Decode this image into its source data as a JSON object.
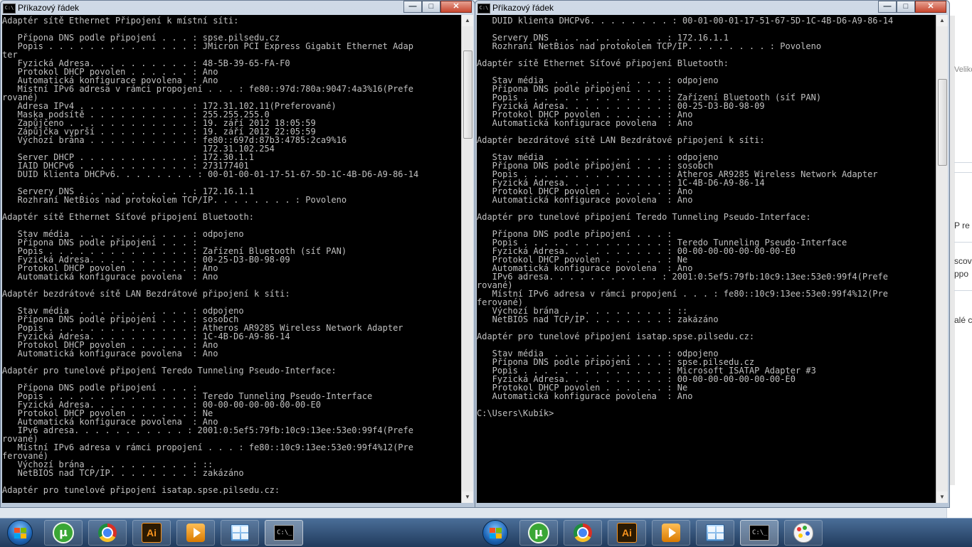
{
  "left_window": {
    "title": "Příkazový řádek",
    "lines": [
      "Adaptér sítě Ethernet Připojení k místní síti:",
      "",
      "   Přípona DNS podle připojení . . . : spse.pilsedu.cz",
      "   Popis . . . . . . . . . . . . . . : JMicron PCI Express Gigabit Ethernet Adap",
      "ter",
      "   Fyzická Adresa. . . . . . . . . . : 48-5B-39-65-FA-F0",
      "   Protokol DHCP povolen . . . . . . : Ano",
      "   Automatická konfigurace povolena  : Ano",
      "   Místní IPv6 adresa v rámci propojení . . . : fe80::97d:780a:9047:4a3%16(Prefe",
      "rované)",
      "   Adresa IPv4 . . . . . . . . . . . : 172.31.102.11(Preferované)",
      "   Maska podsítě . . . . . . . . . . : 255.255.255.0",
      "   Zapůjčeno . . . . . . . . . . . . : 19. září 2012 18:05:59",
      "   Zápůjčka vyprší . . . . . . . . . : 19. září 2012 22:05:59",
      "   Výchozí brána . . . . . . . . . . : fe80::697d:87b3:4785:2ca9%16",
      "                                       172.31.102.254",
      "   Server DHCP . . . . . . . . . . . : 172.30.1.1",
      "   IAID DHCPv6 . . . . . . . . . . . : 273177401",
      "   DUID klienta DHCPv6. . . . . . . . : 00-01-00-01-17-51-67-5D-1C-4B-D6-A9-86-14",
      "",
      "   Servery DNS . . . . . . . . . . . : 172.16.1.1",
      "   Rozhraní NetBios nad protokolem TCP/IP. . . . . . . . : Povoleno",
      "",
      "Adaptér sítě Ethernet Síťové připojení Bluetooth:",
      "",
      "   Stav média  . . . . . . . . . . . : odpojeno",
      "   Přípona DNS podle připojení . . . :",
      "   Popis . . . . . . . . . . . . . . : Zařízení Bluetooth (síť PAN)",
      "   Fyzická Adresa. . . . . . . . . . : 00-25-D3-B0-98-09",
      "   Protokol DHCP povolen . . . . . . : Ano",
      "   Automatická konfigurace povolena  : Ano",
      "",
      "Adaptér bezdrátové sítě LAN Bezdrátové připojení k síti:",
      "",
      "   Stav média  . . . . . . . . . . . : odpojeno",
      "   Přípona DNS podle připojení . . . : sosobch",
      "   Popis . . . . . . . . . . . . . . : Atheros AR9285 Wireless Network Adapter",
      "   Fyzická Adresa. . . . . . . . . . : 1C-4B-D6-A9-86-14",
      "   Protokol DHCP povolen . . . . . . : Ano",
      "   Automatická konfigurace povolena  : Ano",
      "",
      "Adaptér pro tunelové připojení Teredo Tunneling Pseudo-Interface:",
      "",
      "   Přípona DNS podle připojení . . . :",
      "   Popis . . . . . . . . . . . . . . : Teredo Tunneling Pseudo-Interface",
      "   Fyzická Adresa. . . . . . . . . . : 00-00-00-00-00-00-00-E0",
      "   Protokol DHCP povolen . . . . . . : Ne",
      "   Automatická konfigurace povolena  : Ano",
      "   IPv6 adresa. . . . . . . . . . . : 2001:0:5ef5:79fb:10c9:13ee:53e0:99f4(Prefe",
      "rované)",
      "   Místní IPv6 adresa v rámci propojení . . . : fe80::10c9:13ee:53e0:99f4%12(Pre",
      "ferované)",
      "   Výchozí brána . . . . . . . . . . : ::",
      "   NetBIOS nad TCP/IP. . . . . . . . : zakázáno",
      "",
      "Adaptér pro tunelové připojení isatap.spse.pilsedu.cz:"
    ]
  },
  "right_window": {
    "title": "Příkazový řádek",
    "lines": [
      "   DUID klienta DHCPv6. . . . . . . . : 00-01-00-01-17-51-67-5D-1C-4B-D6-A9-86-14",
      "",
      "   Servery DNS . . . . . . . . . . . : 172.16.1.1",
      "   Rozhraní NetBios nad protokolem TCP/IP. . . . . . . . : Povoleno",
      "",
      "Adaptér sítě Ethernet Síťové připojení Bluetooth:",
      "",
      "   Stav média  . . . . . . . . . . . : odpojeno",
      "   Přípona DNS podle připojení . . . :",
      "   Popis . . . . . . . . . . . . . . : Zařízení Bluetooth (síť PAN)",
      "   Fyzická Adresa. . . . . . . . . . : 00-25-D3-B0-98-09",
      "   Protokol DHCP povolen . . . . . . : Ano",
      "   Automatická konfigurace povolena  : Ano",
      "",
      "Adaptér bezdrátové sítě LAN Bezdrátové připojení k síti:",
      "",
      "   Stav média  . . . . . . . . . . . : odpojeno",
      "   Přípona DNS podle připojení . . . : sosobch",
      "   Popis . . . . . . . . . . . . . . : Atheros AR9285 Wireless Network Adapter",
      "   Fyzická Adresa. . . . . . . . . . : 1C-4B-D6-A9-86-14",
      "   Protokol DHCP povolen . . . . . . : Ano",
      "   Automatická konfigurace povolena  : Ano",
      "",
      "Adaptér pro tunelové připojení Teredo Tunneling Pseudo-Interface:",
      "",
      "   Přípona DNS podle připojení . . . :",
      "   Popis . . . . . . . . . . . . . . : Teredo Tunneling Pseudo-Interface",
      "   Fyzická Adresa. . . . . . . . . . : 00-00-00-00-00-00-00-E0",
      "   Protokol DHCP povolen . . . . . . : Ne",
      "   Automatická konfigurace povolena  : Ano",
      "   IPv6 adresa. . . . . . . . . . . : 2001:0:5ef5:79fb:10c9:13ee:53e0:99f4(Prefe",
      "rované)",
      "   Místní IPv6 adresa v rámci propojení . . . : fe80::10c9:13ee:53e0:99f4%12(Pre",
      "ferované)",
      "   Výchozí brána . . . . . . . . . . : ::",
      "   NetBIOS nad TCP/IP. . . . . . . . : zakázáno",
      "",
      "Adaptér pro tunelové připojení isatap.spse.pilsedu.cz:",
      "",
      "   Stav média  . . . . . . . . . . . : odpojeno",
      "   Přípona DNS podle připojení . . . : spse.pilsedu.cz",
      "   Popis . . . . . . . . . . . . . . : Microsoft ISATAP Adapter #3",
      "   Fyzická Adresa. . . . . . . . . . : 00-00-00-00-00-00-00-E0",
      "   Protokol DHCP povolen . . . . . . : Ne",
      "   Automatická konfigurace povolena  : Ano",
      "",
      "C:\\Users\\Kubík>"
    ]
  },
  "window_buttons": {
    "minimize": "—",
    "maximize": "□",
    "close": "✕"
  },
  "background_app": {
    "fragments": [
      "Veliko",
      "P re",
      "scov",
      "ppo",
      "alé c"
    ]
  },
  "taskbar": {
    "left_group": [
      "start-button",
      "utorrent",
      "chrome",
      "illustrator",
      "media-player",
      "control-panel",
      "command-prompt"
    ],
    "right_group": [
      "start-button",
      "utorrent",
      "chrome",
      "illustrator",
      "media-player",
      "control-panel",
      "command-prompt",
      "paint"
    ],
    "icon_labels": {
      "utorrent": "µ",
      "illustrator": "Ai",
      "cmd": "C:\\_"
    }
  },
  "colors": {
    "console_bg": "#000000",
    "console_fg": "#c0c0c0",
    "taskbar": "#2b4a70"
  }
}
